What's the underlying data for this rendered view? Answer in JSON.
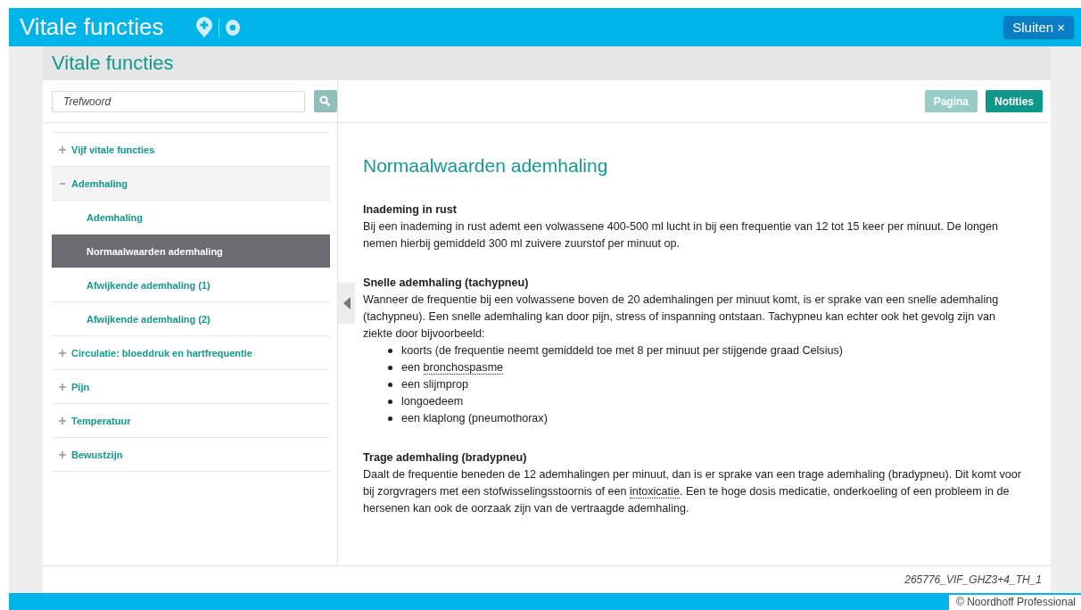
{
  "app_bar": {
    "title": "Vitale functies",
    "close_button": "Sluiten ×"
  },
  "page_title": "Vitale functies",
  "search": {
    "placeholder": "Trefwoord"
  },
  "toolbar": {
    "buttons": [
      {
        "label": "Pagina",
        "disabled": true
      },
      {
        "label": "Notities",
        "disabled": false
      }
    ]
  },
  "tree": [
    {
      "label": "Vijf vitale functies",
      "expanded": false,
      "selected": false
    },
    {
      "label": "Ademhaling",
      "expanded": true,
      "selected": false,
      "children": [
        {
          "label": "Ademhaling",
          "selected": false
        },
        {
          "label": "Normaalwaarden ademhaling",
          "selected": true
        },
        {
          "label": "Afwijkende ademhaling (1)",
          "selected": false
        },
        {
          "label": "Afwijkende ademhaling (2)",
          "selected": false
        }
      ]
    },
    {
      "label": "Circulatie: bloeddruk en hartfrequentie",
      "expanded": false,
      "selected": false
    },
    {
      "label": "Pijn",
      "expanded": false,
      "selected": false
    },
    {
      "label": "Temperatuur",
      "expanded": false,
      "selected": false
    },
    {
      "label": "Bewustzijn",
      "expanded": false,
      "selected": false
    }
  ],
  "article": {
    "title": "Normaalwaarden ademhaling",
    "sections": [
      {
        "heading": "Inademing in rust",
        "paragraph": {
          "text": "Bij een inademing in rust ademt een volwassene 400-500 ml lucht in bij een frequentie van 12 tot 15 keer per minuut. De longen nemen hierbij gemiddeld 300 ml zuivere zuurstof per minuut op."
        }
      },
      {
        "heading": "Snelle ademhaling (tachypneu)",
        "paragraph": {
          "text": "Wanneer de frequentie bij een volwassene boven de 20 ademhalingen per minuut komt, is er sprake van een snelle ademhaling (tachypneu). Een snelle ademhaling kan door pijn, stress of inspanning ontstaan. Tachypneu kan echter ook het gevolg zijn van ziekte door bijvoorbeeld:"
        },
        "list": [
          {
            "text": "koorts (de frequentie neemt gemiddeld toe met 8 per minuut per stijgende graad Celsius)"
          },
          {
            "text": "een ",
            "link": "bronchospasme"
          },
          {
            "text": "een slijmprop"
          },
          {
            "text": "longoedeem"
          },
          {
            "text": "een klaplong (pneumothorax)"
          }
        ]
      },
      {
        "heading": "Trage ademhaling (bradypneu)",
        "paragraph": {
          "text": "Daalt de frequentie beneden de 12 ademhalingen per minuut, dan is er sprake van een trage ademhaling (bradypneu). Dit komt voor bij zorgvragers met een stofwisselingsstoornis of een ",
          "link": "intoxicatie",
          "after": ". Een te hoge dosis medicatie, onderkoeling of een probleem in de hersenen kan ook de oorzaak zijn van de vertraagde ademhaling."
        }
      }
    ]
  },
  "page_code": "265776_VIF_GHZ3+4_TH_1",
  "copyright": "© Noordhoff Professional"
}
